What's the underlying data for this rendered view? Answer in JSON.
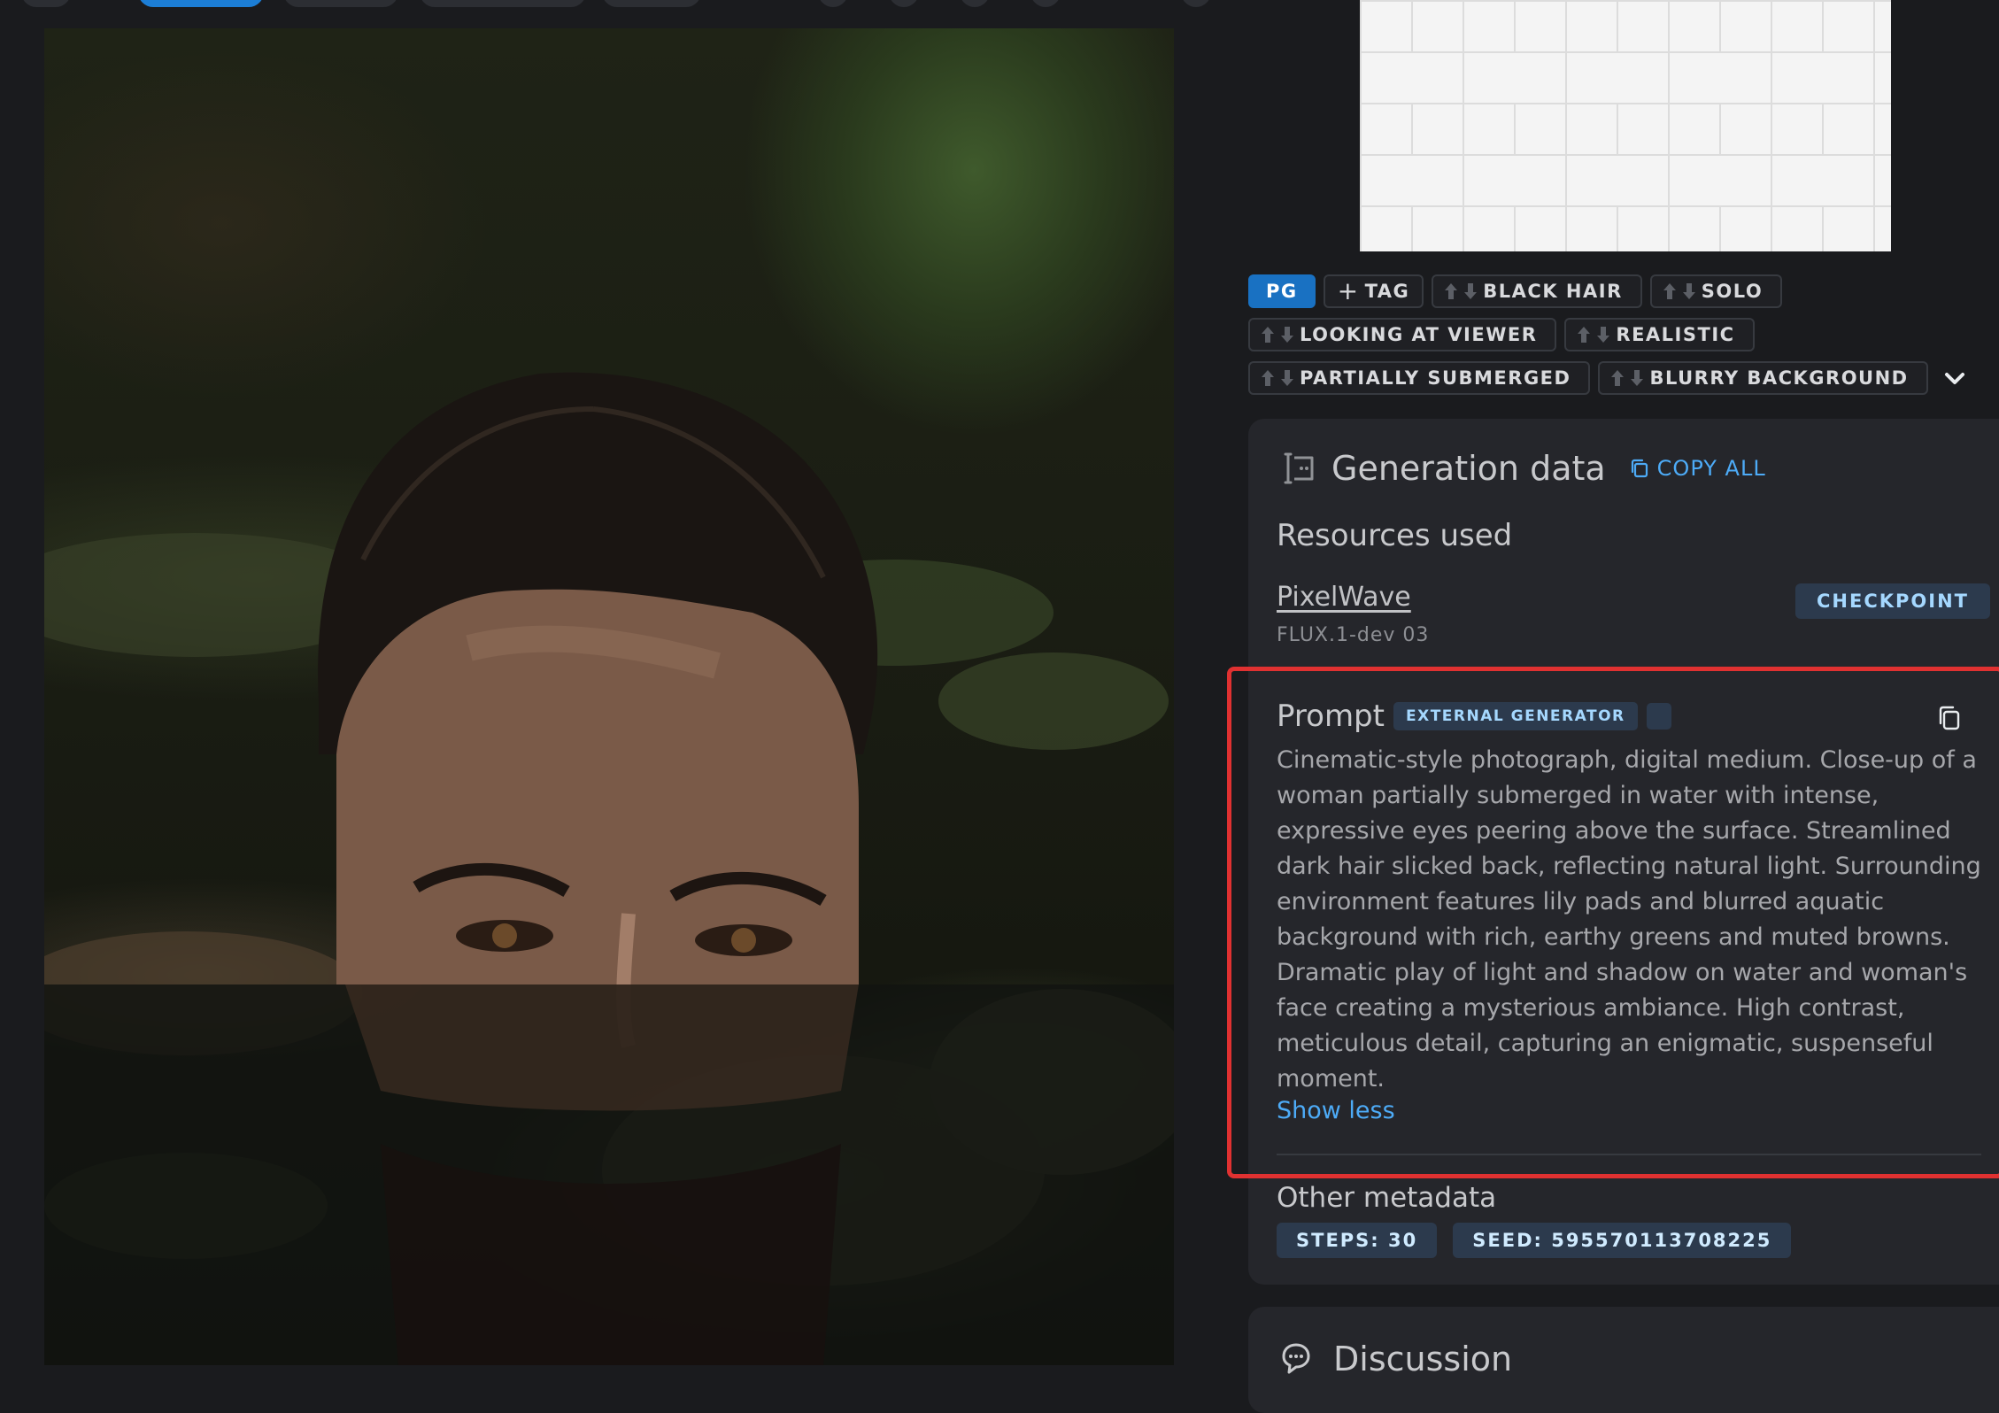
{
  "tags": [
    {
      "label": "PG",
      "kind": "rating"
    },
    {
      "label": "TAG",
      "kind": "add",
      "icon": "plus-icon"
    },
    {
      "label": "BLACK HAIR",
      "kind": "vote"
    },
    {
      "label": "SOLO",
      "kind": "vote"
    },
    {
      "label": "LOOKING AT VIEWER",
      "kind": "vote"
    },
    {
      "label": "REALISTIC",
      "kind": "vote"
    },
    {
      "label": "PARTIALLY SUBMERGED",
      "kind": "vote"
    },
    {
      "label": "BLURRY BACKGROUND",
      "kind": "vote"
    }
  ],
  "generation": {
    "title": "Generation data",
    "copy_all": "COPY ALL",
    "resources_title": "Resources used",
    "resource": {
      "name": "PixelWave",
      "version": "FLUX.1-dev 03",
      "type": "CHECKPOINT"
    },
    "prompt": {
      "title": "Prompt",
      "badge": "EXTERNAL GENERATOR",
      "text": "Cinematic-style photograph, digital medium. Close-up of a woman partially submerged in water with intense, expressive eyes peering above the surface. Streamlined dark hair slicked back, reflecting natural light. Surrounding environment features lily pads and blurred aquatic background with rich, earthy greens and muted browns. Dramatic play of light and shadow on water and woman's face creating a mysterious ambiance. High contrast, meticulous detail, capturing an enigmatic, suspenseful moment.",
      "toggle": "Show less"
    },
    "other_title": "Other metadata",
    "meta": [
      "STEPS: 30",
      "SEED: 595570113708225"
    ]
  },
  "discussion": {
    "title": "Discussion"
  },
  "colors": {
    "accent": "#4dabf7",
    "highlight": "#e03131",
    "rating": "#1971c2"
  }
}
